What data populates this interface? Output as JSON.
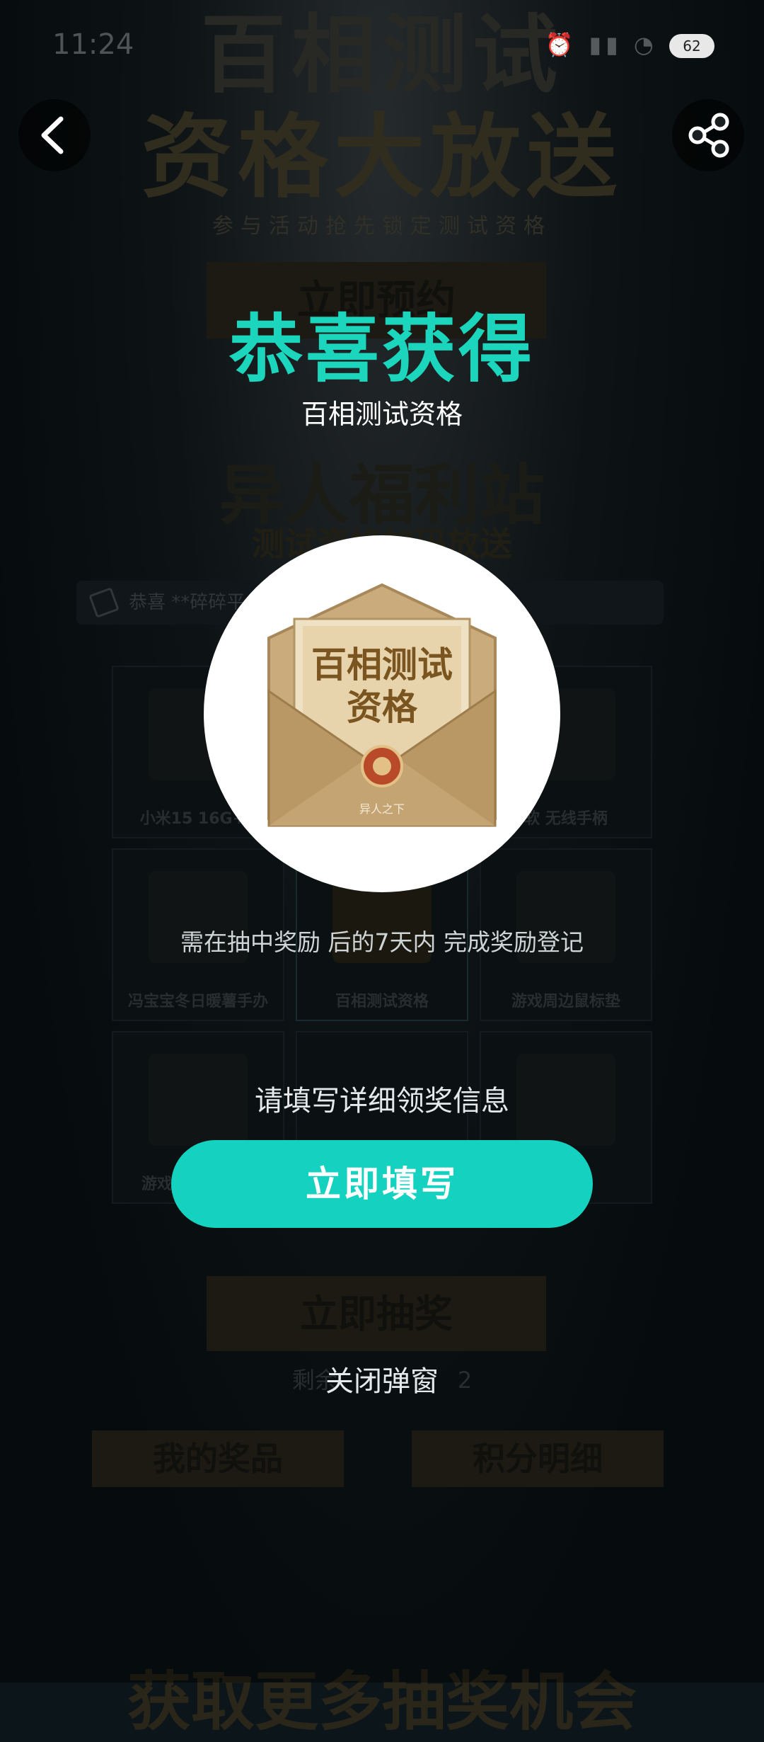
{
  "status_bar": {
    "time": "11:24",
    "battery": "62"
  },
  "background": {
    "title_line1": "百相测试",
    "title_line2": "资格大放送",
    "subtitle": "参与活动抢先锁定测试资格",
    "reserve_button": "立即预约",
    "welfare_title": "异人福利站",
    "welfare_subtitle": "测试资格加码放送",
    "marquee_text": "恭喜 **碎碎平",
    "prizes": [
      {
        "label": "小米15 16G+5"
      },
      {
        "label": ""
      },
      {
        "label": "软 无线手柄"
      },
      {
        "label": "冯宝宝冬日暖薯手办"
      },
      {
        "label": "百相测试资格"
      },
      {
        "label": "游戏周边鼠标垫"
      },
      {
        "label": "游戏"
      },
      {
        "label": ""
      },
      {
        "label": ""
      }
    ],
    "draw_button": "立即抽奖",
    "remaining": "剩余",
    "remaining_count": "2",
    "my_prizes_button": "我的奖品",
    "points_button": "积分明细",
    "bottom_title": "获取更多抽奖机会"
  },
  "popup": {
    "congrats": "恭喜获得",
    "prize_name": "百相测试资格",
    "prize_image_text_line1": "百相测试",
    "prize_image_text_line2": "资格",
    "prize_image_footer": "异人之下",
    "note": "需在抽中奖励 后的7天内 完成奖励登记",
    "fill_tip": "请填写详细领奖信息",
    "fill_button": "立即填写",
    "close_link": "关闭弹窗"
  },
  "icons": {
    "back": "chevron-left-icon",
    "share": "share-icon"
  },
  "colors": {
    "accent": "#14d2bf",
    "congrats_text": "#1bd6bd"
  }
}
